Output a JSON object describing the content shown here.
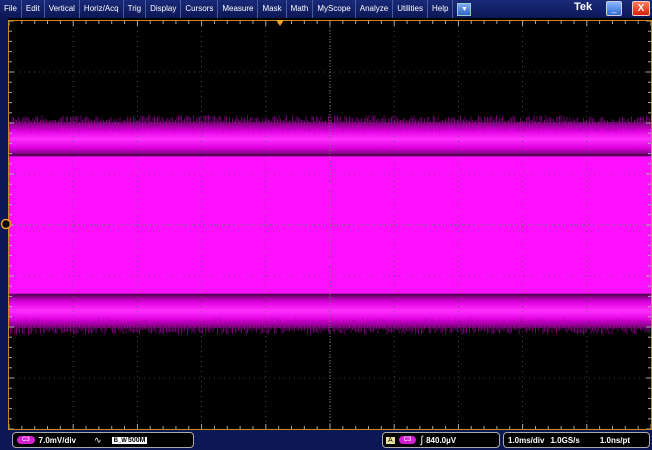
{
  "menu": [
    "File",
    "Edit",
    "Vertical",
    "Horiz/Acq",
    "Trig",
    "Display",
    "Cursors",
    "Measure",
    "Mask",
    "Math",
    "MyScope",
    "Analyze",
    "Utilities",
    "Help"
  ],
  "brand": "Tek",
  "window_buttons": {
    "minimize": "_",
    "close": "X"
  },
  "colors": {
    "trace": "#ff00ff",
    "graticule_border": "#c88a20",
    "trigger_marker": "#f0a020"
  },
  "channel": {
    "label": "C3",
    "scale": "7.0mV/div",
    "bandwidth": "500M",
    "bw_prefix": "B_W"
  },
  "trigger": {
    "source_badge": "A",
    "source": "C3",
    "slope": "rising",
    "level": "840.0µV"
  },
  "horizontal": {
    "scale": "1.0ms/div",
    "sample_rate": "1.0GS/s",
    "resolution": "1.0ns/pt"
  },
  "graticule": {
    "h_divisions": 10,
    "v_divisions": 8
  }
}
